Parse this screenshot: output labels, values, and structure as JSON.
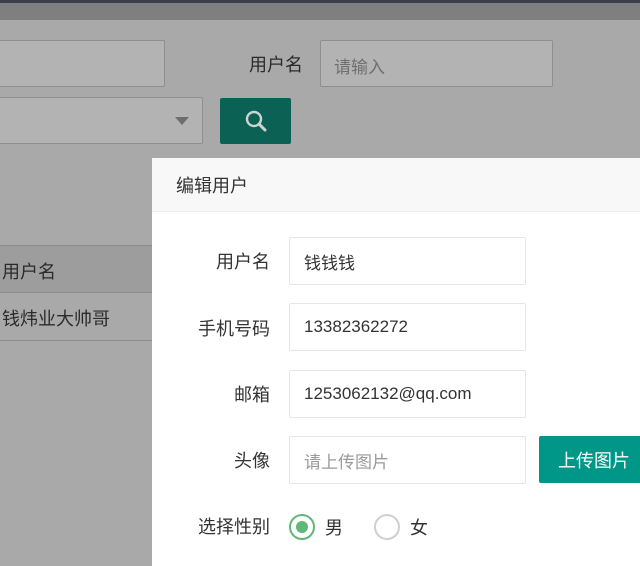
{
  "background": {
    "username_label": "用户名",
    "username_placeholder": "请输入",
    "table": {
      "header": "用户名",
      "rows": [
        "钱炜业大帅哥"
      ]
    }
  },
  "dialog": {
    "title": "编辑用户",
    "fields": {
      "username": {
        "label": "用户名",
        "value": "钱钱钱"
      },
      "phone": {
        "label": "手机号码",
        "value": "13382362272"
      },
      "email": {
        "label": "邮箱",
        "value": "1253062132@qq.com"
      },
      "avatar": {
        "label": "头像",
        "placeholder": "请上传图片",
        "button": "上传图片"
      },
      "gender": {
        "label": "选择性别",
        "options": [
          "男",
          "女"
        ],
        "selected": "男"
      }
    }
  },
  "colors": {
    "primary": "#009688",
    "radio_checked": "#5fb878"
  }
}
